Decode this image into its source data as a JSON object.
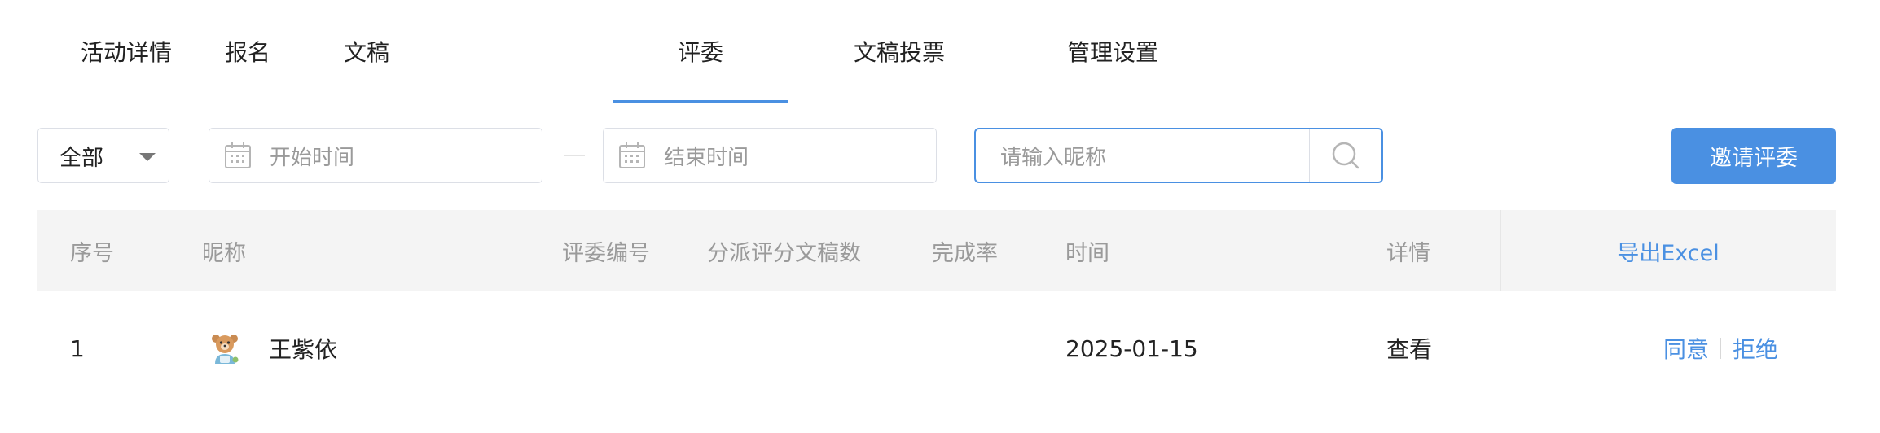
{
  "tabs": [
    {
      "label": "活动详情"
    },
    {
      "label": "报名"
    },
    {
      "label": "文稿"
    },
    {
      "label": "评委"
    },
    {
      "label": "文稿投票"
    },
    {
      "label": "管理设置"
    }
  ],
  "active_tab": "评委",
  "filters": {
    "status_select": "全部",
    "start_placeholder": "开始时间",
    "end_placeholder": "结束时间",
    "search_placeholder": "请输入昵称",
    "invite_button": "邀请评委"
  },
  "table": {
    "columns": [
      "序号",
      "昵称",
      "评委编号",
      "分派评分文稿数",
      "完成率",
      "时间",
      "详情"
    ],
    "export_label": "导出Excel",
    "rows": [
      {
        "index": "1",
        "nickname": "王紫依",
        "judge_no": "",
        "assigned_count": "",
        "completion": "",
        "time": "2025-01-15",
        "detail": "查看",
        "approve": "同意",
        "reject": "拒绝"
      }
    ]
  },
  "colors": {
    "accent": "#4a90e2",
    "header_bg": "#f4f4f4",
    "muted_text": "#9a9a9a"
  },
  "icons": [
    "calendar-icon",
    "search-icon",
    "chevron-down-icon",
    "avatar-bear-icon"
  ]
}
